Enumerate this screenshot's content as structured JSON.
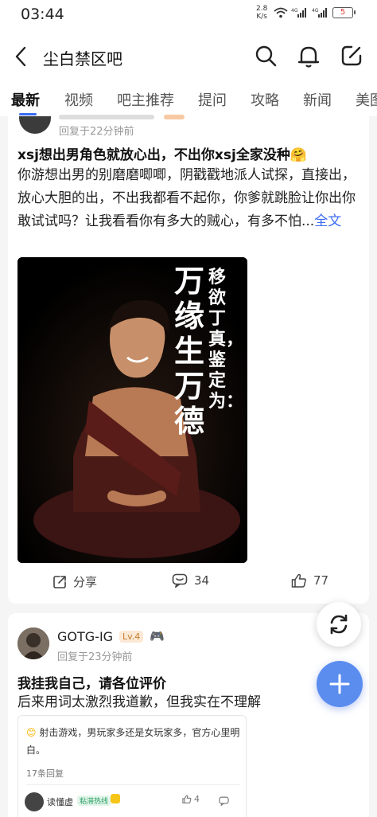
{
  "status_bar": {
    "time": "03:44",
    "net_speed_value": "2.8",
    "net_speed_unit": "K/s",
    "signal1_label": "4G",
    "signal2_label": "4G",
    "battery": "5"
  },
  "header": {
    "title": "尘白禁区吧",
    "icons": [
      "back-arrow",
      "search",
      "bell",
      "edit"
    ]
  },
  "tabs": [
    {
      "label": "最新",
      "active": true
    },
    {
      "label": "视频",
      "active": false
    },
    {
      "label": "吧主推荐",
      "active": false
    },
    {
      "label": "提问",
      "active": false
    },
    {
      "label": "攻略",
      "active": false
    },
    {
      "label": "新闻",
      "active": false
    },
    {
      "label": "美图",
      "active": false
    }
  ],
  "post1": {
    "reply_time": "回复于22分钟前",
    "title": "xsj想出男角色就放心出，不出你xsj全家没种🤗",
    "body": "你游想出男的别磨磨唧唧，阴戳戳地派人试探，直接出，放心大胆的出，不出我都看不起你，你爹就跳脸让你出你敢试试吗？让我看看你有多大的贼心，有多不怕...",
    "more_label": "全文",
    "image_text_big": [
      "万",
      "缘",
      "生",
      "万",
      "德"
    ],
    "image_text_small": "移欲丁真，鉴定为：",
    "share_label": "分享",
    "comment_count": "34",
    "like_count": "77"
  },
  "post2": {
    "username": "GOTG-IG",
    "level": "Lv.4",
    "reply_time": "回复于23分钟前",
    "title": "我挂我自己，请各位评价",
    "body": "后来用词太激烈我道歉，但我实在不理解",
    "quote": {
      "text": "射击游戏，男玩家多还是女玩家多，官方心里明白。",
      "reply_count": "17条回复",
      "reply_user": "读懂虚",
      "reply_badge": "粘滞热线",
      "like_count": "4"
    }
  },
  "colors": {
    "accent": "#3a6cf4",
    "fab": "#5b8def",
    "battery_low": "#e53935"
  }
}
